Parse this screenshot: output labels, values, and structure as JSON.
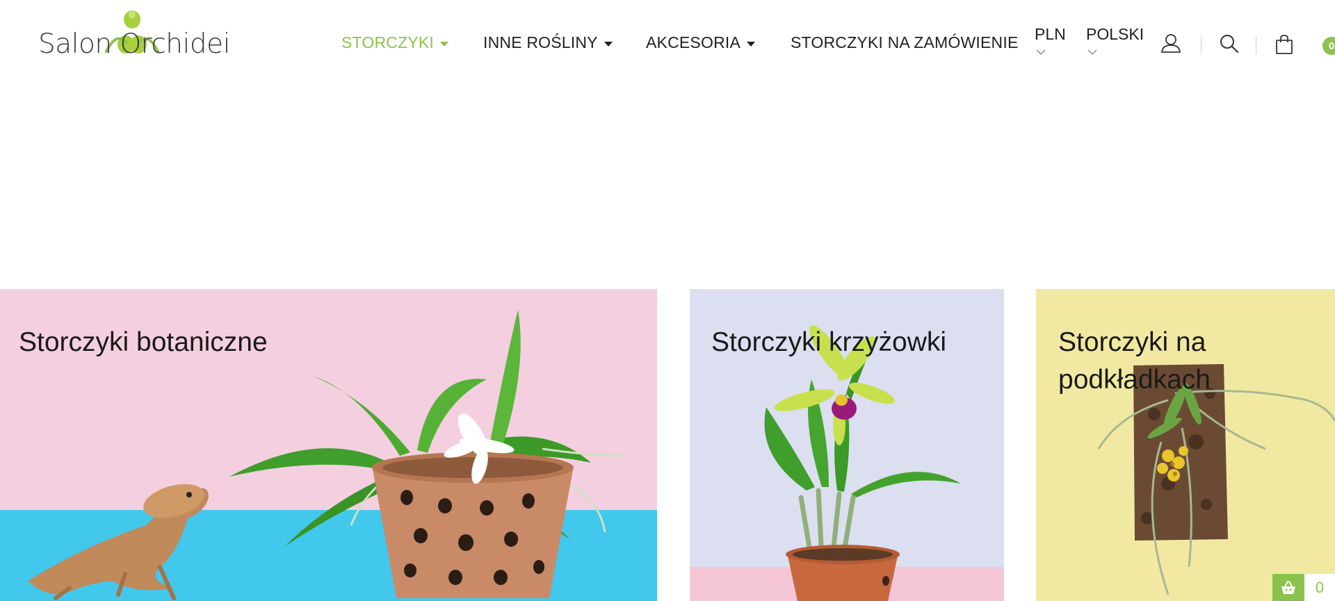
{
  "logo": {
    "text": "Salon Orchidei"
  },
  "nav": [
    {
      "label": "STORCZYKI",
      "has_dropdown": true,
      "active": true
    },
    {
      "label": "INNE ROŚLINY",
      "has_dropdown": true,
      "active": false
    },
    {
      "label": "AKCESORIA",
      "has_dropdown": true,
      "active": false
    },
    {
      "label": "STORCZYKI NA ZAMÓWIENIE",
      "has_dropdown": false,
      "active": false
    }
  ],
  "currency": {
    "selected": "PLN"
  },
  "language": {
    "selected": "POLSKI"
  },
  "header_icons": {
    "account": "user-icon",
    "search": "search-icon",
    "cart": "shopping-bag-icon"
  },
  "cart": {
    "count": "0"
  },
  "categories": [
    {
      "title": "Storczyki botaniczne",
      "colors": [
        "#f3cfe0",
        "#42c8ec"
      ]
    },
    {
      "title": "Storczyki krzyżowki",
      "colors": [
        "#dcdff0",
        "#f4c6d6"
      ]
    },
    {
      "title": "Storczyki na podkładkach",
      "colors": [
        "#f1e9a2"
      ]
    }
  ],
  "floating_cart": {
    "count": "0",
    "icon": "basket-icon"
  },
  "colors": {
    "accent": "#8cc24c",
    "text": "#1f1f1f"
  }
}
